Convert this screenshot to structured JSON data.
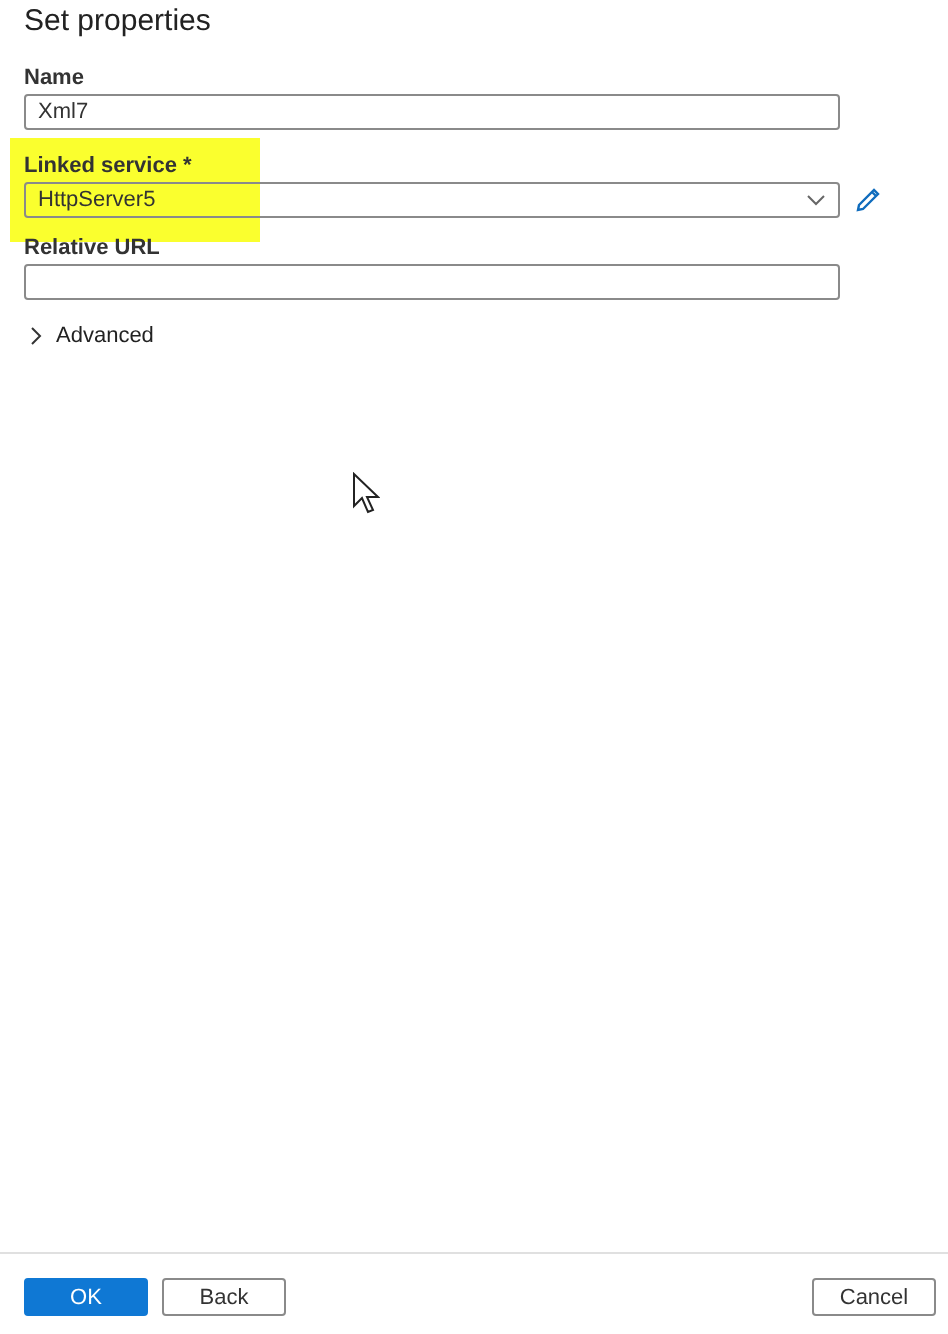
{
  "title": "Set properties",
  "fields": [
    {
      "label": "Name",
      "kind": "text",
      "value": "Xml7",
      "highlighted": false
    },
    {
      "label": "Linked service *",
      "kind": "dropdown",
      "value": "HttpServer5",
      "highlighted": true
    },
    {
      "label": "Relative URL",
      "kind": "text",
      "highlighted": false
    }
  ],
  "advanced": {
    "label": "Advanced",
    "expanded": false
  },
  "buttons": [
    {
      "label": "OK",
      "kind": "primary"
    },
    {
      "label": "Back",
      "kind": "default"
    },
    {
      "label": "Cancel",
      "kind": "default"
    }
  ]
}
